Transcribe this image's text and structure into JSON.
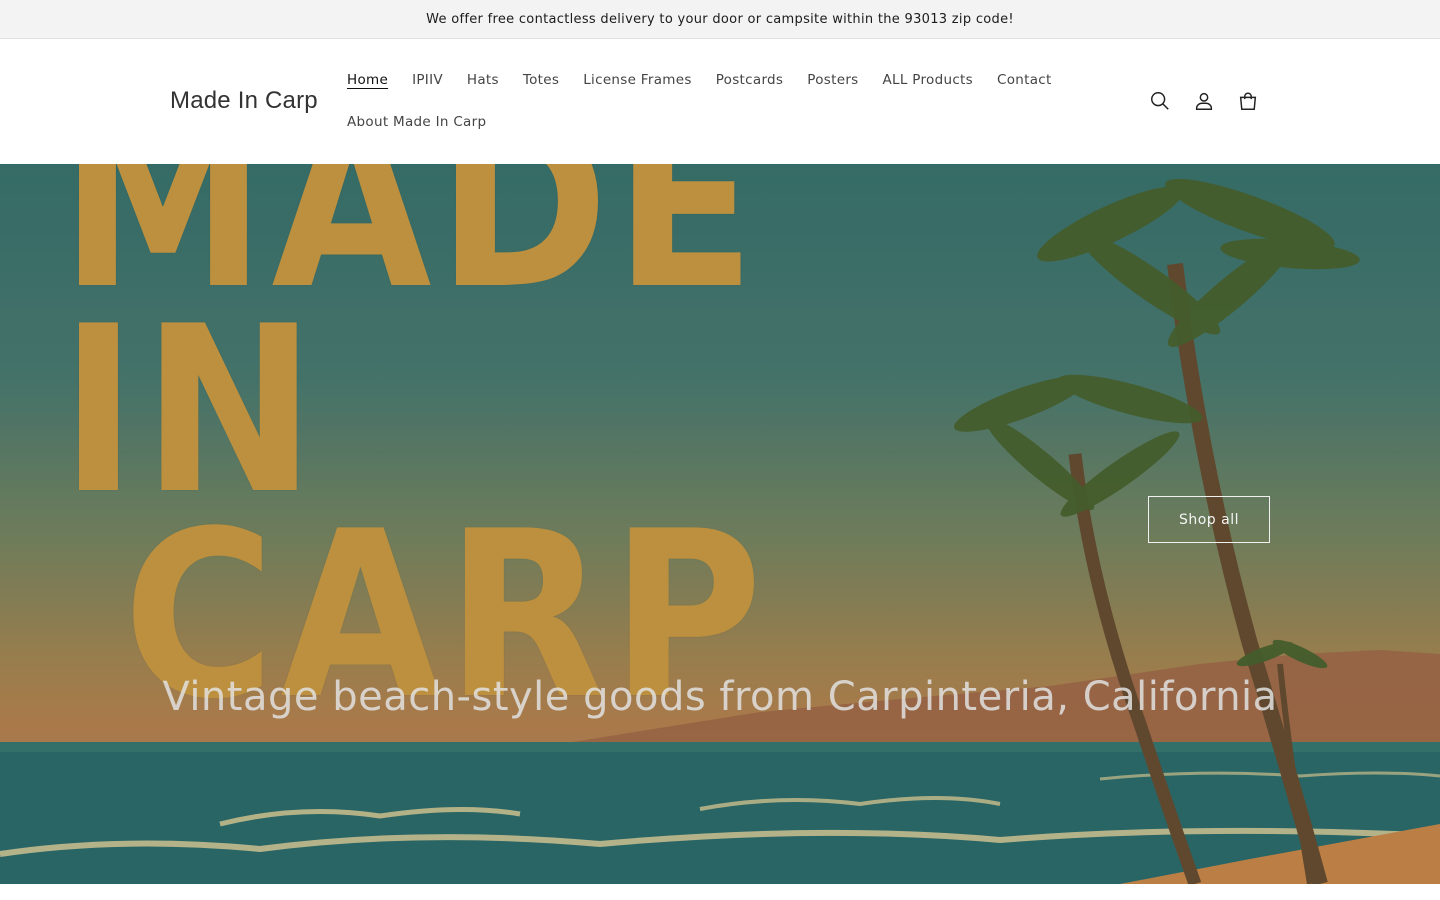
{
  "announcement": "We offer free contactless delivery to your door or campsite within the 93013 zip code!",
  "logo": "Made In Carp",
  "nav": {
    "row1": [
      "Home",
      "IPIIV",
      "Hats",
      "Totes",
      "License Frames",
      "Postcards",
      "Posters",
      "ALL Products",
      "Contact"
    ],
    "row2": [
      "About Made In Carp"
    ],
    "active": "Home"
  },
  "header_icons": [
    "search-icon",
    "account-icon",
    "cart-icon"
  ],
  "hero": {
    "title_line1": "MADE IN",
    "title_line2": "CARP",
    "button_label": "Shop all",
    "tagline": "Vintage beach-style goods from Carpinteria, California"
  },
  "colors": {
    "title": "#d6a447",
    "sky_top": "#3d7a75",
    "ocean": "#2f7474",
    "sand": "#d5914f"
  }
}
